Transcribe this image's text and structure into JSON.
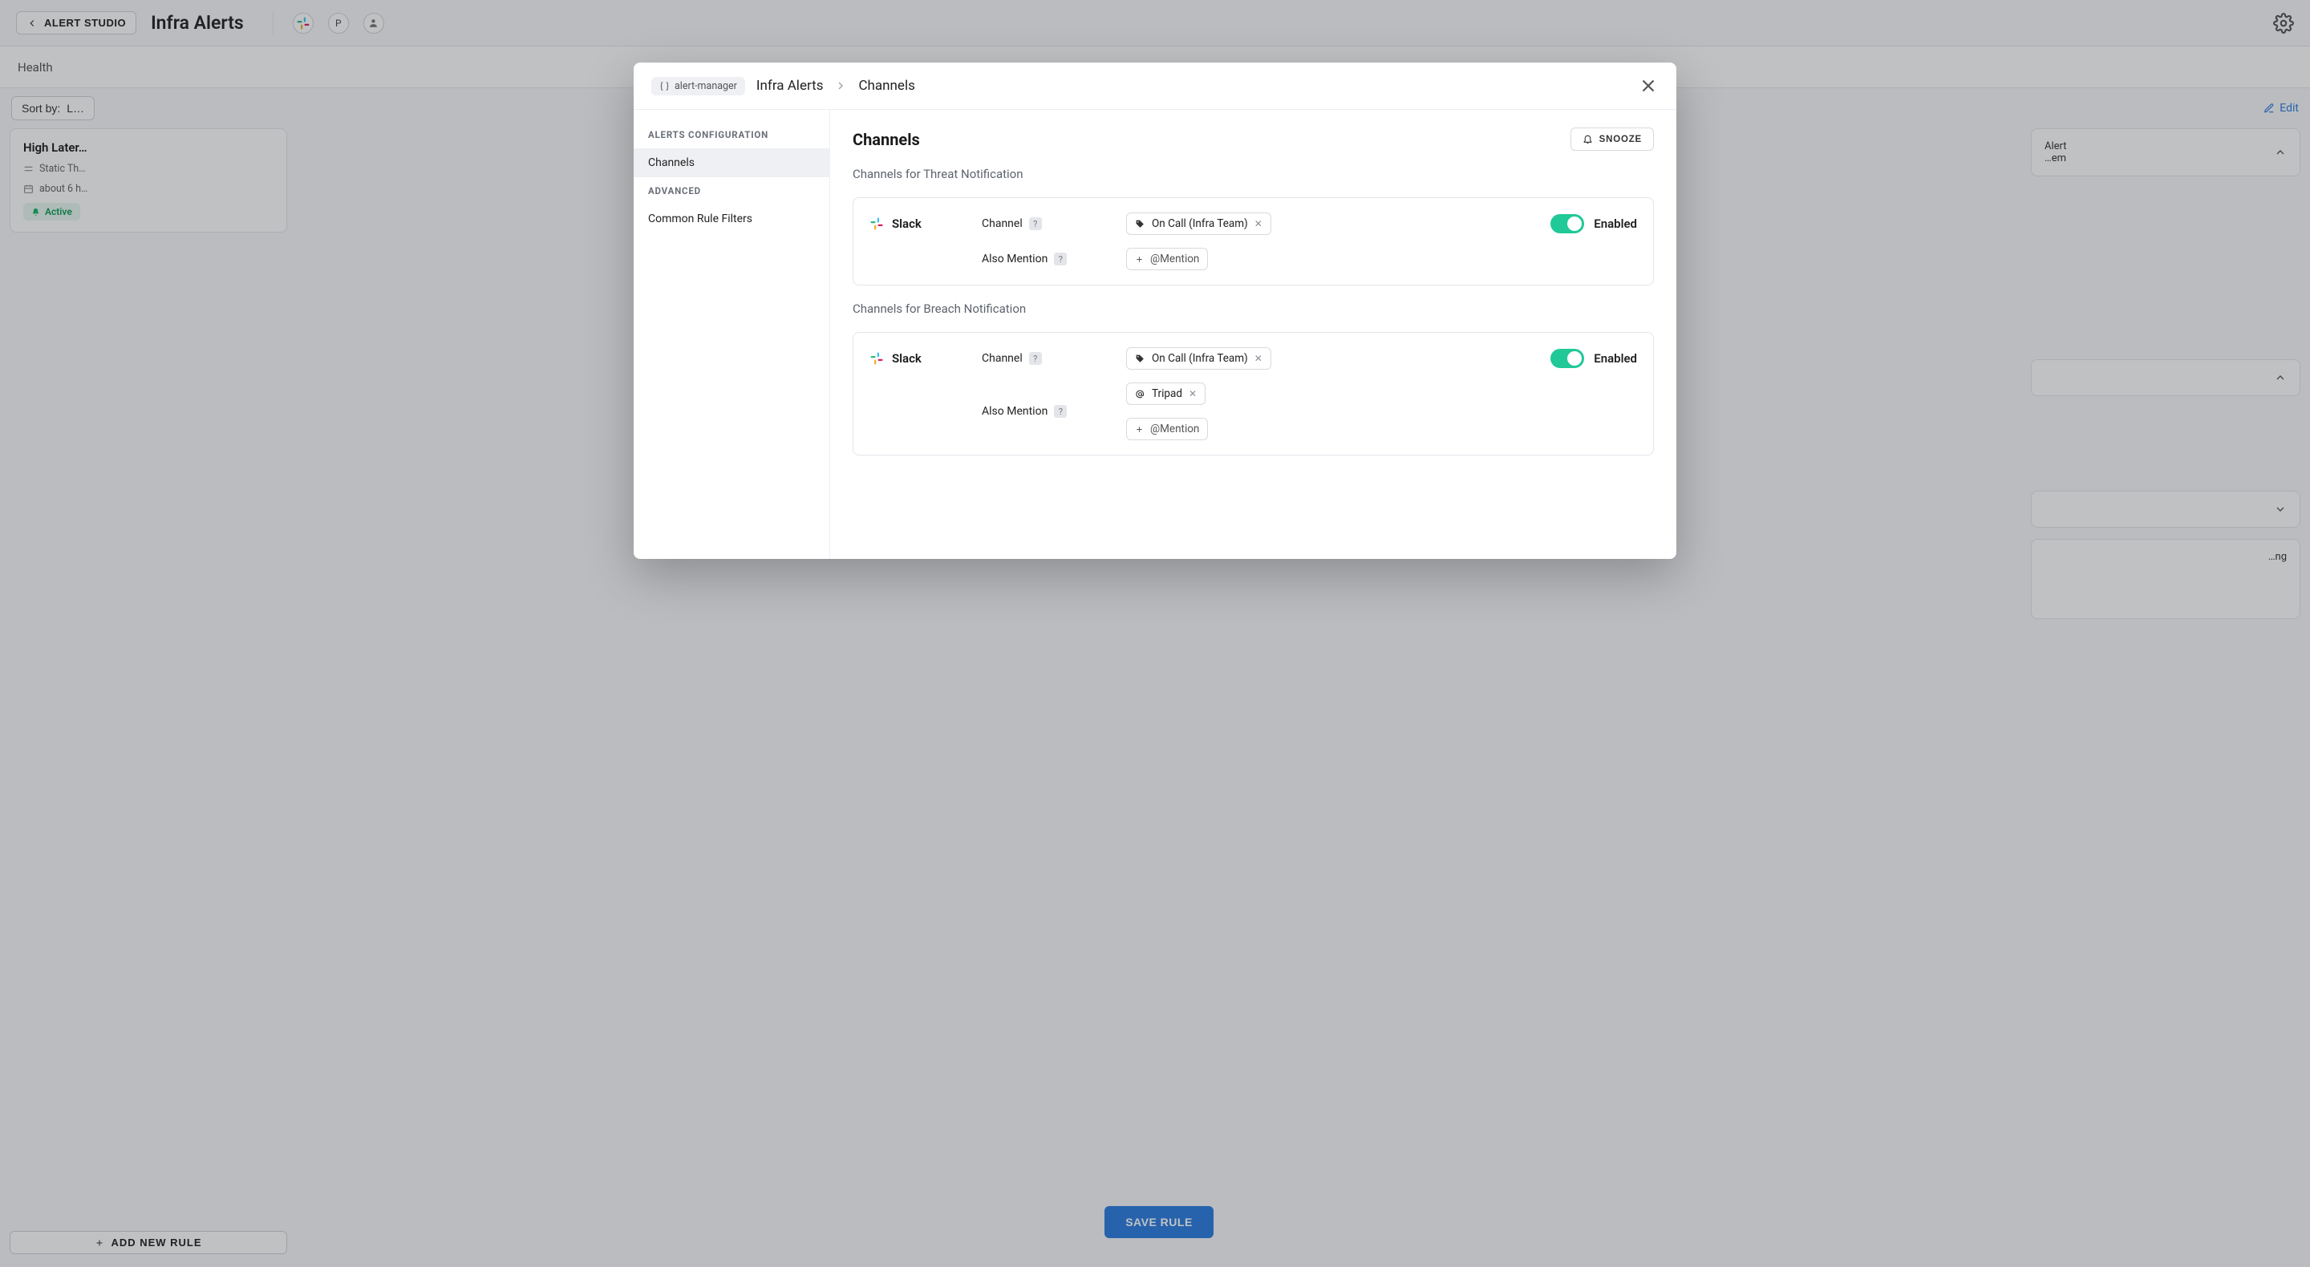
{
  "topbar": {
    "back_label": "ALERT STUDIO",
    "title": "Infra Alerts",
    "avatar_initial": "P"
  },
  "subbar": {
    "tabs": [
      "Health"
    ]
  },
  "toolbar": {
    "sort_label": "Sort by:",
    "sort_value": "L…",
    "edit_label": "Edit"
  },
  "left": {
    "rule": {
      "title": "High Later…",
      "type": "Static Th…",
      "time": "about 6 h…",
      "status": "Active"
    },
    "add_rule_label": "ADD NEW RULE"
  },
  "mid": {
    "save_label": "SAVE RULE"
  },
  "right": {
    "card1_line1": "Alert",
    "card1_line2": "…em",
    "card3_text": "…ng"
  },
  "modal": {
    "pill": "alert-manager",
    "crumbs": [
      "Infra Alerts",
      "Channels"
    ],
    "side": {
      "group1": "ALERTS CONFIGURATION",
      "item1": "Channels",
      "group2": "ADVANCED",
      "item2": "Common Rule Filters"
    },
    "main": {
      "title": "Channels",
      "snooze": "SNOOZE",
      "section_threat": "Channels for Threat Notification",
      "section_breach": "Channels for Breach Notification",
      "slack": "Slack",
      "channel_label": "Channel",
      "mention_label": "Also Mention",
      "tag_oncall": "On Call (Infra Team)",
      "tag_tripad": "Tripad",
      "add_mention": "@Mention",
      "enabled": "Enabled"
    }
  }
}
